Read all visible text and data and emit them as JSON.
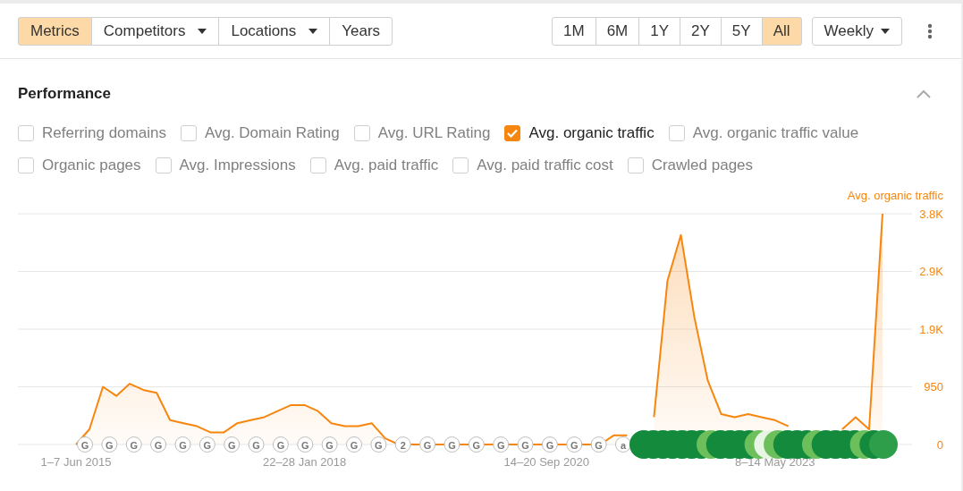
{
  "toolbar": {
    "view_tabs": [
      {
        "label": "Metrics",
        "selected": true,
        "has_menu": false
      },
      {
        "label": "Competitors",
        "selected": false,
        "has_menu": true
      },
      {
        "label": "Locations",
        "selected": false,
        "has_menu": true
      },
      {
        "label": "Years",
        "selected": false,
        "has_menu": false
      }
    ],
    "ranges": [
      {
        "label": "1M",
        "selected": false
      },
      {
        "label": "6M",
        "selected": false
      },
      {
        "label": "1Y",
        "selected": false
      },
      {
        "label": "2Y",
        "selected": false
      },
      {
        "label": "5Y",
        "selected": false
      },
      {
        "label": "All",
        "selected": true
      }
    ],
    "interval": {
      "label": "Weekly"
    }
  },
  "section": {
    "title": "Performance",
    "expanded": true
  },
  "metric_rows": [
    [
      {
        "label": "Referring domains",
        "checked": false
      },
      {
        "label": "Avg. Domain Rating",
        "checked": false
      },
      {
        "label": "Avg. URL Rating",
        "checked": false
      },
      {
        "label": "Avg. organic traffic",
        "checked": true
      },
      {
        "label": "Avg. organic traffic value",
        "checked": false
      }
    ],
    [
      {
        "label": "Organic pages",
        "checked": false
      },
      {
        "label": "Avg. Impressions",
        "checked": false
      },
      {
        "label": "Avg. paid traffic",
        "checked": false
      },
      {
        "label": "Avg. paid traffic cost",
        "checked": false
      },
      {
        "label": "Crawled pages",
        "checked": false
      }
    ]
  ],
  "chart": {
    "chart_data": {
      "type": "area",
      "grid": true,
      "ylim": [
        0,
        3800
      ],
      "categories": [
        "1–7 Jun 2015",
        null,
        null,
        null,
        null,
        null,
        null,
        null,
        null,
        null,
        null,
        null,
        null,
        null,
        null,
        null,
        null,
        "22–28 Jan 2018",
        null,
        null,
        null,
        null,
        null,
        null,
        null,
        null,
        null,
        null,
        null,
        null,
        null,
        null,
        null,
        null,
        null,
        "14–20 Sep 2020",
        null,
        null,
        null,
        null,
        null,
        null,
        null,
        null,
        null,
        null,
        null,
        null,
        null,
        null,
        null,
        null,
        "8–14 May 2023",
        null,
        null,
        null,
        null,
        null,
        null,
        null,
        null
      ],
      "series": [
        {
          "name": "Avg. organic traffic",
          "color": "#f7860f",
          "values": [
            0,
            250,
            950,
            800,
            1000,
            900,
            850,
            400,
            350,
            300,
            200,
            200,
            350,
            400,
            450,
            550,
            650,
            650,
            550,
            350,
            300,
            300,
            350,
            100,
            0,
            0,
            0,
            0,
            0,
            0,
            0,
            0,
            0,
            0,
            0,
            0,
            0,
            0,
            0,
            0,
            150,
            150,
            null,
            450,
            2700,
            3450,
            2100,
            1050,
            500,
            450,
            500,
            450,
            400,
            300,
            null,
            null,
            null,
            250,
            450,
            250,
            3800
          ]
        }
      ],
      "yticks": [
        {
          "value": 0,
          "label": "0"
        },
        {
          "value": 950,
          "label": "950"
        },
        {
          "value": 1900,
          "label": "1.9K"
        },
        {
          "value": 2850,
          "label": "2.9K"
        },
        {
          "value": 3800,
          "label": "3.8K"
        }
      ]
    },
    "event_badges": [
      {
        "text": "G"
      },
      {
        "text": "G"
      },
      {
        "text": "G"
      },
      {
        "text": "G"
      },
      {
        "text": "G"
      },
      {
        "text": "G"
      },
      {
        "text": "G"
      },
      {
        "text": "G"
      },
      {
        "text": "G"
      },
      {
        "text": "G"
      },
      {
        "text": "G"
      },
      {
        "text": "G"
      },
      {
        "text": "G"
      },
      {
        "text": "2"
      },
      {
        "text": "G"
      },
      {
        "text": "G"
      },
      {
        "text": "G"
      },
      {
        "text": "G"
      },
      {
        "text": "G"
      },
      {
        "text": "G"
      },
      {
        "text": "G"
      },
      {
        "text": "G"
      },
      {
        "text": "a"
      }
    ],
    "update_markers": [
      {
        "color": "#138a3c"
      },
      {
        "color": "#138a3c"
      },
      {
        "color": "#138a3c"
      },
      {
        "color": "#138a3c"
      },
      {
        "color": "#138a3c"
      },
      {
        "color": "#138a3c"
      },
      {
        "color": "#138a3c"
      },
      {
        "color": "#6cbf5a"
      },
      {
        "color": "#138a3c"
      },
      {
        "color": "#138a3c"
      },
      {
        "color": "#138a3c"
      },
      {
        "color": "#138a3c"
      },
      {
        "color": "#6cbf5a"
      },
      {
        "color": "#e8f5e4"
      },
      {
        "color": "#6cbf5a"
      },
      {
        "color": "#138a3c"
      },
      {
        "color": "#138a3c"
      },
      {
        "color": "#138a3c"
      },
      {
        "color": "#6cbf5a"
      },
      {
        "color": "#138a3c"
      },
      {
        "color": "#138a3c"
      },
      {
        "color": "#138a3c"
      },
      {
        "color": "#138a3c"
      },
      {
        "color": "#6cbf5a"
      },
      {
        "color": "#138a3c"
      },
      {
        "color": "#2e9e4a"
      }
    ]
  }
}
